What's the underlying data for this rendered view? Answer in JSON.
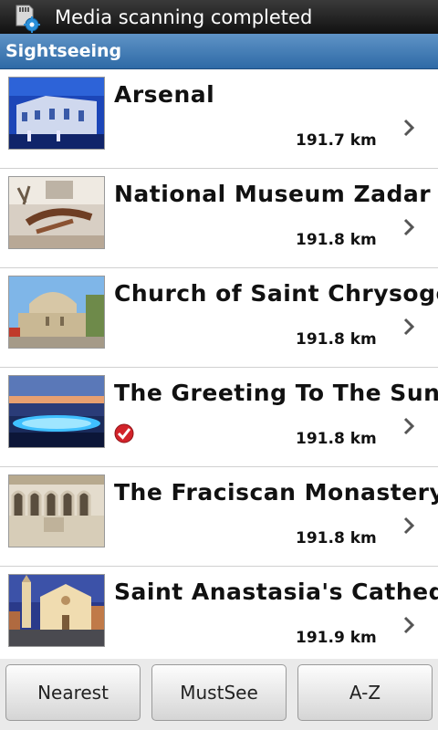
{
  "status_bar": {
    "text": "Media scanning completed",
    "icon": "sd-card-scan-icon"
  },
  "header": {
    "title": "Sightseeing"
  },
  "items": [
    {
      "name": "Arsenal",
      "distance": "191.7 km",
      "thumb": "arsenal-photo",
      "must_see": false
    },
    {
      "name": "National Museum Zadar",
      "distance": "191.8 km",
      "thumb": "museum-photo",
      "must_see": false
    },
    {
      "name": "Church of Saint Chrysogon",
      "distance": "191.8 km",
      "thumb": "church-photo",
      "must_see": false
    },
    {
      "name": "The Greeting To The Sun",
      "distance": "191.8 km",
      "thumb": "greeting-sun-photo",
      "must_see": true
    },
    {
      "name": "The Fraciscan Monastery",
      "distance": "191.8 km",
      "thumb": "monastery-photo",
      "must_see": false
    },
    {
      "name": "Saint Anastasia's Cathedra",
      "distance": "191.9 km",
      "thumb": "cathedral-photo",
      "must_see": false
    }
  ],
  "tabs": {
    "nearest": "Nearest",
    "mustsee": "MustSee",
    "az": "A-Z"
  },
  "colors": {
    "header_blue": "#3f7ab5",
    "status_bg": "#1a1a1a",
    "check_red": "#d2232a"
  }
}
